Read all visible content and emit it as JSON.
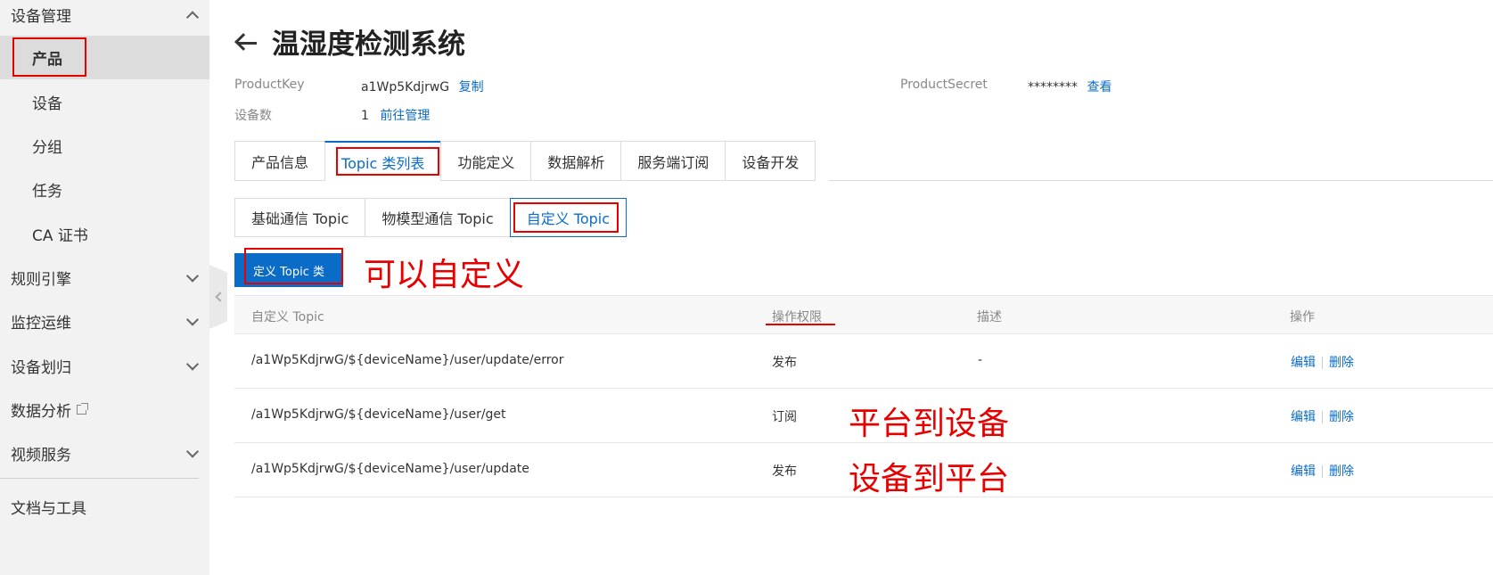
{
  "sidebar": {
    "device_mgmt": "设备管理",
    "product": "产品",
    "device": "设备",
    "group": "分组",
    "task": "任务",
    "ca_cert": "CA 证书",
    "rule_engine": "规则引擎",
    "monitor_ops": "监控运维",
    "device_assign": "设备划归",
    "data_analysis": "数据分析",
    "video_service": "视频服务",
    "docs_tools": "文档与工具"
  },
  "header": {
    "title": "温湿度检测系统"
  },
  "meta": {
    "product_key_label": "ProductKey",
    "product_key_value": "a1Wp5KdjrwG",
    "copy_link": "复制",
    "product_secret_label": "ProductSecret",
    "product_secret_value": "********",
    "view_link": "查看",
    "device_count_label": "设备数",
    "device_count_value": "1",
    "manage_link": "前往管理"
  },
  "tabs": [
    "产品信息",
    "Topic 类列表",
    "功能定义",
    "数据解析",
    "服务端订阅",
    "设备开发"
  ],
  "subtabs": [
    "基础通信 Topic",
    "物模型通信 Topic",
    "自定义 Topic"
  ],
  "actions": {
    "define_topic_button": "定义 Topic 类"
  },
  "annotations": {
    "customizable": "可以自定义",
    "platform_to_device": "平台到设备",
    "device_to_platform": "设备到平台"
  },
  "table": {
    "headers": {
      "topic": "自定义 Topic",
      "permission": "操作权限",
      "description": "描述",
      "operation": "操作"
    },
    "rows": [
      {
        "topic": "/a1Wp5KdjrwG/${deviceName}/user/update/error",
        "permission": "发布",
        "description": "-",
        "edit": "编辑",
        "delete": "删除"
      },
      {
        "topic": "/a1Wp5KdjrwG/${deviceName}/user/get",
        "permission": "订阅",
        "description": "",
        "edit": "编辑",
        "delete": "删除"
      },
      {
        "topic": "/a1Wp5KdjrwG/${deviceName}/user/update",
        "permission": "发布",
        "description": "",
        "edit": "编辑",
        "delete": "删除"
      }
    ]
  },
  "colors": {
    "accent": "#0b6cc7",
    "annotation_red": "#e60000",
    "sidebar_bg": "#f2f2f2"
  }
}
